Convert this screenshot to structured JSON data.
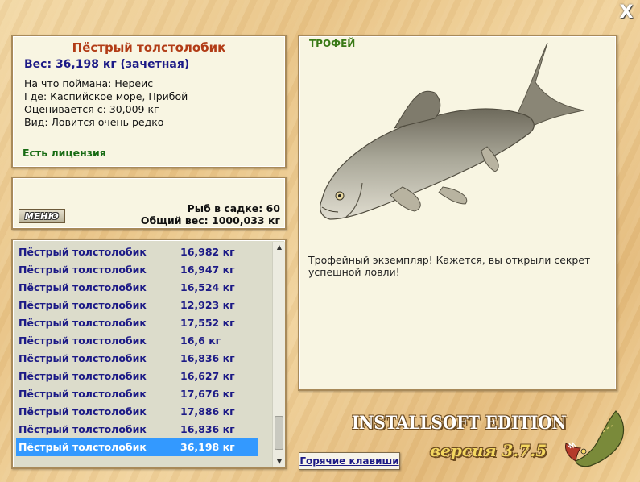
{
  "window": {
    "close_symbol": "X"
  },
  "info": {
    "fish_name": "Пёстрый толстолобик",
    "weight_line": "Вес: 36,198 кг (зачетная)",
    "caught_on": "На что поймана: Нереис",
    "location": "Где: Каспийское море, Прибой",
    "evaluated_from": "Оценивается с: 30,009 кг",
    "species_note": "Вид: Ловится очень редко",
    "license": "Есть лицензия"
  },
  "summary": {
    "menu_label": "МЕНЮ",
    "fish_in_keepnet": "Рыб в садке: 60",
    "total_weight": "Общий вес: 1000,033 кг"
  },
  "catch_list": [
    {
      "name": "Пёстрый толстолобик",
      "weight": "16,982 кг"
    },
    {
      "name": "Пёстрый толстолобик",
      "weight": "16,947 кг"
    },
    {
      "name": "Пёстрый толстолобик",
      "weight": "16,524 кг"
    },
    {
      "name": "Пёстрый толстолобик",
      "weight": "12,923 кг"
    },
    {
      "name": "Пёстрый толстолобик",
      "weight": "17,552 кг"
    },
    {
      "name": "Пёстрый толстолобик",
      "weight": "16,6 кг"
    },
    {
      "name": "Пёстрый толстолобик",
      "weight": "16,836 кг"
    },
    {
      "name": "Пёстрый толстолобик",
      "weight": "16,627 кг"
    },
    {
      "name": "Пёстрый толстолобик",
      "weight": "17,676 кг"
    },
    {
      "name": "Пёстрый толстолобик",
      "weight": "17,886 кг"
    },
    {
      "name": "Пёстрый толстолобик",
      "weight": "16,836 кг"
    },
    {
      "name": "Пёстрый толстолобик",
      "weight": "36,198 кг",
      "selected": true
    }
  ],
  "trophy": {
    "label": "ТРОФЕЙ",
    "text": "Трофейный экземпляр! Кажется, вы открыли секрет успешной ловли!"
  },
  "footer": {
    "hotkeys_label": "Горячие клавиши",
    "brand": "INSTALLSOFT EDITION",
    "version": "версия 3.7.5"
  },
  "colors": {
    "accent_title": "#b23c16",
    "list_text": "#1c1a86",
    "license_text": "#176b13",
    "selection": "#3399ff"
  }
}
